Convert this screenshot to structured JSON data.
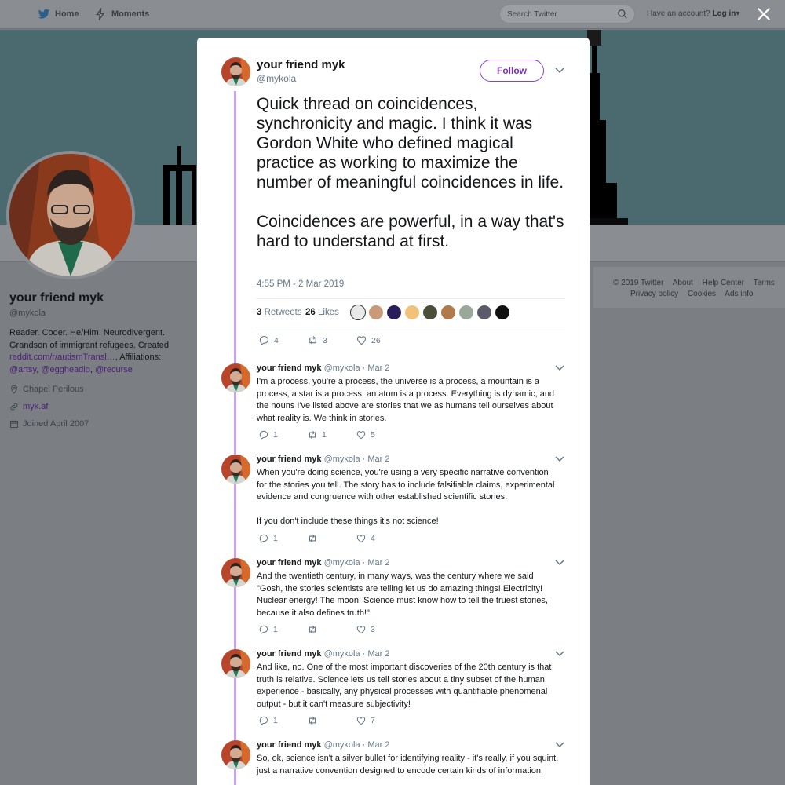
{
  "topbar": {
    "home_label": "Home",
    "moments_label": "Moments",
    "search_placeholder": "Search Twitter",
    "account_prompt": "Have an account?",
    "login_label": "Log in"
  },
  "profile": {
    "name": "your friend myk",
    "handle": "@mykola",
    "bio_text": "Reader. Coder. He/Him. Neurodivergent. Grandson of immigrant refugees. Created",
    "bio_link": "reddit.com/r/autismTransl…",
    "bio_after": ", Affiliations:",
    "affiliations": [
      "@artsy",
      "@eggheadio",
      "@recurse"
    ],
    "location": "Chapel Perilous",
    "website": "myk.af",
    "joined": "Joined April 2007"
  },
  "footer": {
    "row1": [
      "© 2019 Twitter",
      "About",
      "Help Center",
      "Terms"
    ],
    "row2": [
      "Privacy policy",
      "Cookies",
      "Ads info"
    ]
  },
  "tweet": {
    "name": "your friend myk",
    "handle": "@mykola",
    "follow_label": "Follow",
    "text": "Quick thread on coincidences, synchronicity and magic. I think it was Gordon White who defined magical practice as working to maximize the number of meaningful coincidences in life.\n\nCoincidences are powerful, in a way that's hard to understand at first.",
    "timestamp": "4:55 PM - 2 Mar 2019",
    "retweets_count": "3",
    "retweets_label": "Retweets",
    "likes_count": "26",
    "likes_label": "Likes",
    "reply_count": "4",
    "retweet_action_count": "3",
    "like_action_count": "26"
  },
  "replies": [
    {
      "name": "your friend myk",
      "handle": "@mykola",
      "date": "· Mar 2",
      "text": "I'm a process, you're a process, the universe is a process, a mountain is a process, a star is a process, an atom is a process. Everything is dynamic, and the nouns I've listed above are stories that we as humans tell ourselves about what reality is. We think in stories.",
      "replies": "1",
      "retweets": "1",
      "likes": "5"
    },
    {
      "name": "your friend myk",
      "handle": "@mykola",
      "date": "· Mar 2",
      "text": "When you're doing science, you're using a very specific narrative convention for the stories you tell. The story has to include falsifiable claims, experimental evidence and congruence with other established scientific stories.\n\nIf you don't include these things it's not science!",
      "replies": "1",
      "retweets": "",
      "likes": "4"
    },
    {
      "name": "your friend myk",
      "handle": "@mykola",
      "date": "· Mar 2",
      "text": "And the twentieth century, in many ways, was the century where we said \"Gosh, the stories scientists are telling let us do amazing things! Electricity! Nuclear energy! The moon! Science must know how to tell the truest stories, because it also defines truth!\"",
      "replies": "1",
      "retweets": "",
      "likes": "3"
    },
    {
      "name": "your friend myk",
      "handle": "@mykola",
      "date": "· Mar 2",
      "text": "And like, no. One of the most important discoveries of the 20th century is that truth is relative. Science lets us tell stories about a tiny subset of the human experience - basically, any physical processes with quantifiable phenomenal output - but it can't measure subjectivity!",
      "replies": "1",
      "retweets": "",
      "likes": "7"
    },
    {
      "name": "your friend myk",
      "handle": "@mykola",
      "date": "· Mar 2",
      "text": "So, ok, science isn't a silver bullet for identifying reality - it's really, if you squint, just a narrative convention designed to encode certain kinds of information.",
      "replies": "",
      "retweets": "",
      "likes": ""
    }
  ],
  "colors": {
    "accent": "#7b2fc2",
    "thread_line": "#c9a4e9",
    "muted": "#657786"
  }
}
